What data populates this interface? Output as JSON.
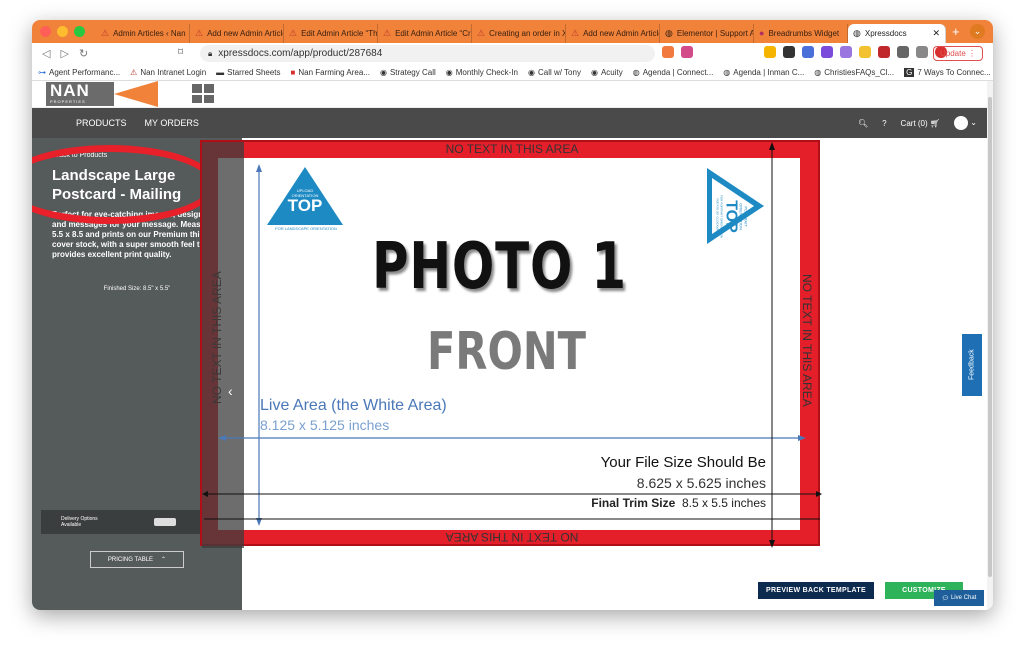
{
  "browser": {
    "tabs": [
      {
        "label": "Admin Articles ‹ Nan",
        "icon": "alert-icon"
      },
      {
        "label": "Add new Admin Article",
        "icon": "alert-icon"
      },
      {
        "label": "Edit Admin Article “Th",
        "icon": "alert-icon"
      },
      {
        "label": "Edit Admin Article “Cr",
        "icon": "alert-icon"
      },
      {
        "label": "Creating an order in X",
        "icon": "alert-icon"
      },
      {
        "label": "Add new Admin Article",
        "icon": "alert-icon"
      },
      {
        "label": "Elementor | Support A",
        "icon": "globe-icon"
      },
      {
        "label": "Breadrumbs Widget",
        "icon": "b-icon"
      },
      {
        "label": "Xpressdocs",
        "icon": "globe-icon",
        "active": true
      }
    ],
    "url": "xpressdocs.com/app/product/287684",
    "update_label": "Update",
    "bookmarks": [
      {
        "label": "Agent Performanc..."
      },
      {
        "label": "Nan Intranet Login"
      },
      {
        "label": "Starred Sheets"
      },
      {
        "label": "Nan Farming Area..."
      },
      {
        "label": "Strategy Call"
      },
      {
        "label": "Monthly Check-In"
      },
      {
        "label": "Call w/ Tony"
      },
      {
        "label": "Acuity"
      },
      {
        "label": "Agenda | Connect..."
      },
      {
        "label": "Agenda | Inman C..."
      },
      {
        "label": "ChristiesFAQs_Cl..."
      },
      {
        "label": "7 Ways To Connec..."
      }
    ]
  },
  "site": {
    "logo": "NAN",
    "logo_sub": "PROPERTIES",
    "nav": {
      "products": "PRODUCTS",
      "orders": "MY ORDERS",
      "cart": "Cart (0)"
    },
    "sidebar": {
      "back": "Back to Products",
      "title": "Landscape Large Postcard - Mailing",
      "description": "Perfect for eye-catching images, designs and messages for your message. Measures 5.5 x 8.5 and prints on our Premium thick cover stock, with a super smooth feel that provides excellent print quality.",
      "finished_size": "Finished Size: 8.5\" x 5.5\"",
      "delivery": "Delivery Options Available",
      "pricing": "PRICING TABLE"
    },
    "template": {
      "no_text": "NO TEXT IN THIS AREA",
      "photo": "PHOTO 1",
      "front": "FRONT",
      "live_area": "Live Area (the White Area)",
      "live_size": "8.125 x 5.125 inches",
      "file_size_title": "Your File Size Should Be",
      "file_size": "8.625 x 5.625 inches",
      "trim_label": "Final Trim Size",
      "trim_size": "8.5 x 5.5 inches",
      "upload_left": {
        "line1": "UPLOAD",
        "line2": "ORIENTATION",
        "big": "TOP",
        "line3": "FOR LANDSCAPE ORIENTATION"
      },
      "upload_right": {
        "line1": "PORTRAIT",
        "line2": "ORIENTATION",
        "big": "TOP",
        "line3": "FOR PORTRAIT ORIENTATION",
        "line4": "ROTATE 90° CLOCKWISE"
      }
    },
    "buttons": {
      "preview": "PREVIEW BACK TEMPLATE",
      "customize": "CUSTOMIZE"
    },
    "feedback": "Feedback",
    "livechat": "Live Chat"
  },
  "colors": {
    "tab_bar": "#f0823a",
    "red_border": "#e51f2a",
    "preview_btn": "#0d2a4f",
    "customize_btn": "#2eb35a",
    "sidebar": "#555a5a"
  }
}
